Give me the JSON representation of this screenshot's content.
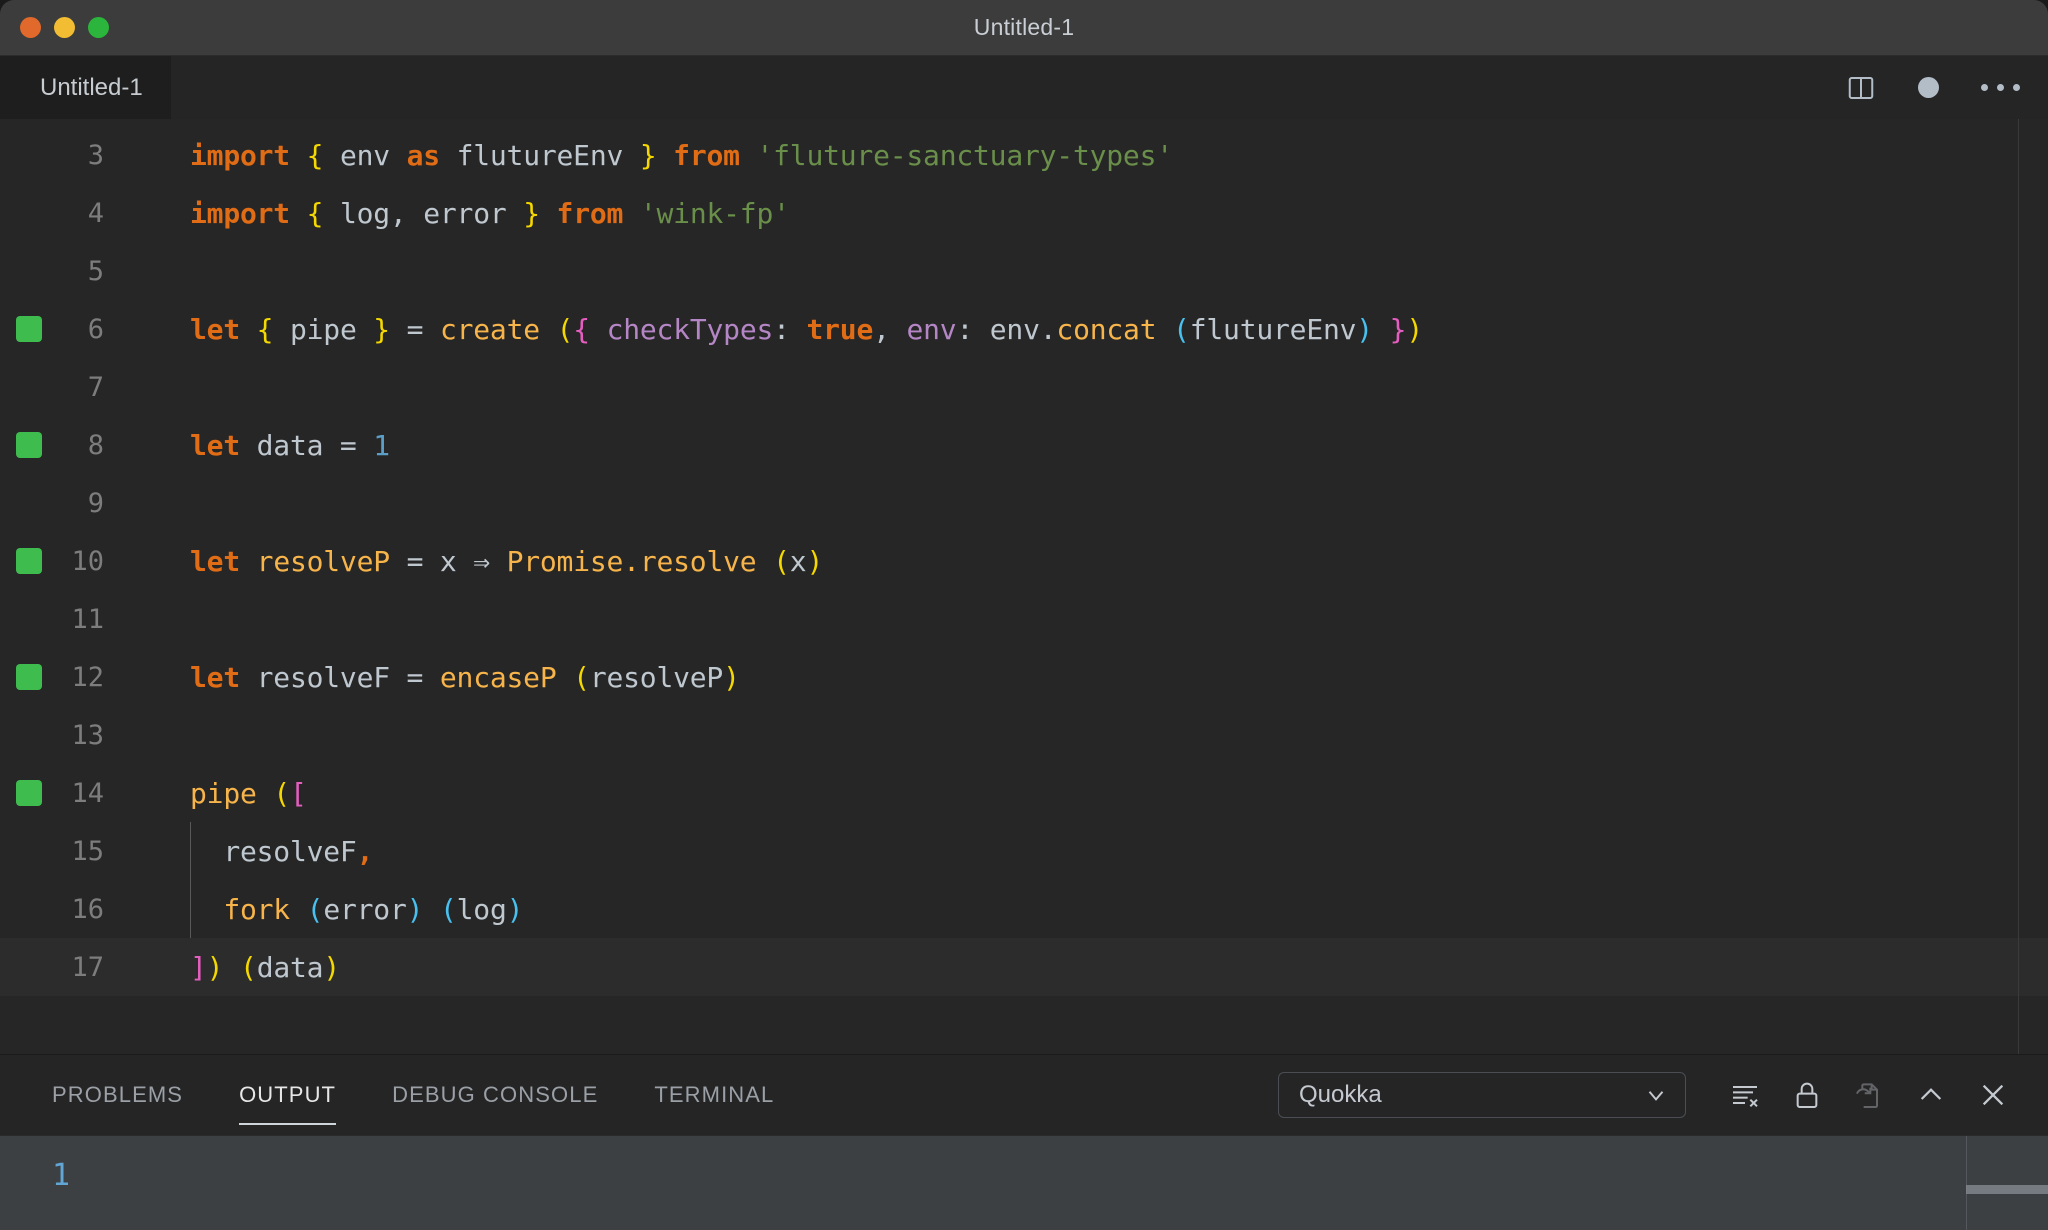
{
  "window": {
    "title": "Untitled-1",
    "traffic_lights": [
      "close",
      "minimize",
      "maximize"
    ]
  },
  "tabbar": {
    "tab_label": "Untitled-1",
    "actions": [
      {
        "name": "split-editor-icon",
        "label": "Split Editor"
      },
      {
        "name": "unsaved-dot-icon",
        "label": "Unsaved"
      },
      {
        "name": "more-actions-icon",
        "label": "More Actions..."
      }
    ]
  },
  "editor": {
    "lines": [
      {
        "num": "3",
        "marker": false,
        "active": false,
        "indent_guide": false,
        "tokens": [
          {
            "t": "import",
            "c": "t-kw"
          },
          {
            "t": " ",
            "c": "t-op"
          },
          {
            "t": "{",
            "c": "b-y"
          },
          {
            "t": " env ",
            "c": "t-var"
          },
          {
            "t": "as",
            "c": "t-kw"
          },
          {
            "t": " flutureEnv ",
            "c": "t-var"
          },
          {
            "t": "}",
            "c": "b-y"
          },
          {
            "t": " ",
            "c": "t-op"
          },
          {
            "t": "from",
            "c": "t-kw"
          },
          {
            "t": " ",
            "c": "t-op"
          },
          {
            "t": "'fluture-sanctuary-types'",
            "c": "t-str"
          }
        ]
      },
      {
        "num": "4",
        "marker": false,
        "active": false,
        "indent_guide": false,
        "tokens": [
          {
            "t": "import",
            "c": "t-kw"
          },
          {
            "t": " ",
            "c": "t-op"
          },
          {
            "t": "{",
            "c": "b-y"
          },
          {
            "t": " log, error ",
            "c": "t-var"
          },
          {
            "t": "}",
            "c": "b-y"
          },
          {
            "t": " ",
            "c": "t-op"
          },
          {
            "t": "from",
            "c": "t-kw"
          },
          {
            "t": " ",
            "c": "t-op"
          },
          {
            "t": "'wink-fp'",
            "c": "t-str"
          }
        ]
      },
      {
        "num": "5",
        "marker": false,
        "active": false,
        "indent_guide": false,
        "tokens": []
      },
      {
        "num": "6",
        "marker": true,
        "active": false,
        "indent_guide": false,
        "tokens": [
          {
            "t": "let",
            "c": "t-kw"
          },
          {
            "t": " ",
            "c": "t-op"
          },
          {
            "t": "{",
            "c": "b-y"
          },
          {
            "t": " pipe ",
            "c": "t-var"
          },
          {
            "t": "}",
            "c": "b-y"
          },
          {
            "t": " = ",
            "c": "t-op"
          },
          {
            "t": "create",
            "c": "t-fn"
          },
          {
            "t": " ",
            "c": "t-op"
          },
          {
            "t": "(",
            "c": "b-y"
          },
          {
            "t": "{",
            "c": "b-p"
          },
          {
            "t": " ",
            "c": "t-op"
          },
          {
            "t": "checkTypes",
            "c": "t-prop"
          },
          {
            "t": ": ",
            "c": "t-op"
          },
          {
            "t": "true",
            "c": "t-kw"
          },
          {
            "t": ", ",
            "c": "t-op"
          },
          {
            "t": "env",
            "c": "t-prop"
          },
          {
            "t": ": ",
            "c": "t-op"
          },
          {
            "t": "env",
            "c": "t-var"
          },
          {
            "t": ".",
            "c": "t-op"
          },
          {
            "t": "concat",
            "c": "t-fn"
          },
          {
            "t": " ",
            "c": "t-op"
          },
          {
            "t": "(",
            "c": "b-c"
          },
          {
            "t": "flutureEnv",
            "c": "t-var"
          },
          {
            "t": ")",
            "c": "b-c"
          },
          {
            "t": " ",
            "c": "t-op"
          },
          {
            "t": "}",
            "c": "b-p"
          },
          {
            "t": ")",
            "c": "b-y"
          }
        ]
      },
      {
        "num": "7",
        "marker": false,
        "active": false,
        "indent_guide": false,
        "tokens": []
      },
      {
        "num": "8",
        "marker": true,
        "active": false,
        "indent_guide": false,
        "tokens": [
          {
            "t": "let",
            "c": "t-kw"
          },
          {
            "t": " data = ",
            "c": "t-var"
          },
          {
            "t": "1",
            "c": "t-num"
          }
        ]
      },
      {
        "num": "9",
        "marker": false,
        "active": false,
        "indent_guide": false,
        "tokens": []
      },
      {
        "num": "10",
        "marker": true,
        "active": false,
        "indent_guide": false,
        "tokens": [
          {
            "t": "let",
            "c": "t-kw"
          },
          {
            "t": " ",
            "c": "t-op"
          },
          {
            "t": "resolveP",
            "c": "t-fn"
          },
          {
            "t": " = x ",
            "c": "t-var"
          },
          {
            "t": "⇒",
            "c": "t-op"
          },
          {
            "t": " ",
            "c": "t-op"
          },
          {
            "t": "Promise.resolve",
            "c": "t-fn"
          },
          {
            "t": " ",
            "c": "t-op"
          },
          {
            "t": "(",
            "c": "b-y"
          },
          {
            "t": "x",
            "c": "t-var"
          },
          {
            "t": ")",
            "c": "b-y"
          }
        ]
      },
      {
        "num": "11",
        "marker": false,
        "active": false,
        "indent_guide": false,
        "tokens": []
      },
      {
        "num": "12",
        "marker": true,
        "active": false,
        "indent_guide": false,
        "tokens": [
          {
            "t": "let",
            "c": "t-kw"
          },
          {
            "t": " resolveF = ",
            "c": "t-var"
          },
          {
            "t": "encaseP",
            "c": "t-fn"
          },
          {
            "t": " ",
            "c": "t-op"
          },
          {
            "t": "(",
            "c": "b-y"
          },
          {
            "t": "resolveP",
            "c": "t-var"
          },
          {
            "t": ")",
            "c": "b-y"
          }
        ]
      },
      {
        "num": "13",
        "marker": false,
        "active": false,
        "indent_guide": false,
        "tokens": []
      },
      {
        "num": "14",
        "marker": true,
        "active": false,
        "indent_guide": false,
        "tokens": [
          {
            "t": "pipe",
            "c": "t-fn"
          },
          {
            "t": " ",
            "c": "t-op"
          },
          {
            "t": "(",
            "c": "b-y"
          },
          {
            "t": "[",
            "c": "b-p"
          }
        ]
      },
      {
        "num": "15",
        "marker": false,
        "active": false,
        "indent_guide": true,
        "tokens": [
          {
            "t": "  resolveF",
            "c": "t-var"
          },
          {
            "t": ",",
            "c": "t-kw"
          }
        ]
      },
      {
        "num": "16",
        "marker": false,
        "active": false,
        "indent_guide": true,
        "tokens": [
          {
            "t": "  ",
            "c": "t-op"
          },
          {
            "t": "fork",
            "c": "t-fn"
          },
          {
            "t": " ",
            "c": "t-op"
          },
          {
            "t": "(",
            "c": "b-c"
          },
          {
            "t": "error",
            "c": "t-var"
          },
          {
            "t": ")",
            "c": "b-c"
          },
          {
            "t": " ",
            "c": "t-op"
          },
          {
            "t": "(",
            "c": "b-c"
          },
          {
            "t": "log",
            "c": "t-var"
          },
          {
            "t": ")",
            "c": "b-c"
          }
        ]
      },
      {
        "num": "17",
        "marker": false,
        "active": true,
        "indent_guide": false,
        "tokens": [
          {
            "t": "]",
            "c": "b-p"
          },
          {
            "t": ")",
            "c": "b-y"
          },
          {
            "t": " ",
            "c": "t-op"
          },
          {
            "t": "(",
            "c": "b-y"
          },
          {
            "t": "data",
            "c": "t-var"
          },
          {
            "t": ")",
            "c": "b-y"
          }
        ]
      }
    ]
  },
  "panel": {
    "tabs": [
      {
        "label": "PROBLEMS",
        "active": false
      },
      {
        "label": "OUTPUT",
        "active": true
      },
      {
        "label": "DEBUG CONSOLE",
        "active": false
      },
      {
        "label": "TERMINAL",
        "active": false
      }
    ],
    "channel_select": {
      "value": "Quokka",
      "chevron": "chevron-down-icon"
    },
    "actions": [
      {
        "name": "clear-output-icon",
        "label": "Clear Output",
        "dim": false
      },
      {
        "name": "lock-scroll-icon",
        "label": "Turn Auto Scrolling Off",
        "dim": false
      },
      {
        "name": "open-in-editor-icon",
        "label": "Open Output in Editor",
        "dim": true
      },
      {
        "name": "maximize-panel-icon",
        "label": "Maximize Panel Size",
        "dim": false
      },
      {
        "name": "close-panel-icon",
        "label": "Close Panel",
        "dim": false
      }
    ],
    "output_lines": [
      "1"
    ]
  },
  "colors": {
    "titlebar_bg": "#3c3c3c",
    "tabbar_bg": "#252526",
    "editor_bg": "#262626",
    "panel_bg": "#252526",
    "output_bg": "#3c4043",
    "quokka_marker_green": "#3ebd4e",
    "keyword_orange": "#e06c15",
    "string_green": "#6a8f4a",
    "function_amber": "#f6b44a",
    "property_purple": "#b586c6",
    "number_blue": "#5b9ec8",
    "bracket_yellow": "#f5d800",
    "bracket_pink": "#e45ec0",
    "bracket_cyan": "#49c1f0",
    "output_text_blue": "#61a6d4"
  }
}
